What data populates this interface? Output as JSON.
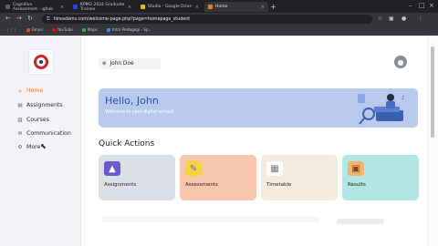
{
  "browser": {
    "tabs": [
      {
        "label": "Cognitive Assessment - ighub"
      },
      {
        "label": "KPMG 2024 Graduate Trainee"
      },
      {
        "label": "Studio - Google Drive"
      },
      {
        "label": "Home"
      }
    ],
    "url": "hireadams.com/welcome-page.php?page=homepage_student",
    "bookmarks": [
      {
        "label": "Gmail",
        "color": "#ea4335"
      },
      {
        "label": "YouTube",
        "color": "#ff0000"
      },
      {
        "label": "Maps",
        "color": "#34a853"
      },
      {
        "label": "Intro Pedagogi - Sp..",
        "color": "#4285f4"
      }
    ]
  },
  "sidebar": {
    "items": [
      {
        "label": "Home",
        "icon": "home-icon",
        "glyph": "⌂"
      },
      {
        "label": "Assignments",
        "icon": "assignment-icon",
        "glyph": "▤"
      },
      {
        "label": "Courses",
        "icon": "book-icon",
        "glyph": "▥"
      },
      {
        "label": "Communication",
        "icon": "chat-icon",
        "glyph": "✉"
      },
      {
        "label": "More",
        "icon": "more-icon",
        "glyph": "⚙"
      }
    ]
  },
  "header": {
    "user_name": "John Doe"
  },
  "banner": {
    "title": "Hello, John",
    "subtitle": "Welcome to your digital school!"
  },
  "quick_actions": {
    "title": "Quick Actions",
    "cards": [
      {
        "label": "Assignments",
        "bg": "#dce0e6",
        "icon_bg": "#6a5acd"
      },
      {
        "label": "Assessments",
        "bg": "#f8c6ad",
        "icon_bg": "#f4d43a"
      },
      {
        "label": "Timetable",
        "bg": "#f3ecdf",
        "icon_bg": "#ffffff"
      },
      {
        "label": "Results",
        "bg": "#b2e6e2",
        "icon_bg": "#f2b46b"
      }
    ]
  },
  "colors": {
    "accent": "#e57a2e",
    "banner": "#b9c9ee",
    "hello": "#2f4fb5"
  }
}
